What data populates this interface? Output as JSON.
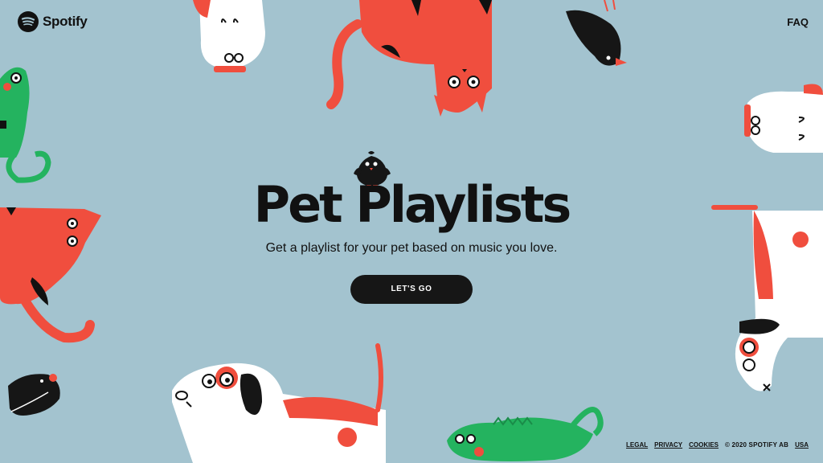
{
  "header": {
    "brand": "Spotify",
    "faq_label": "FAQ"
  },
  "hero": {
    "title": "Pet Playlists",
    "subtitle": "Get a playlist for your pet based on music you love.",
    "cta_label": "LET'S GO"
  },
  "footer": {
    "links": [
      "LEGAL",
      "PRIVACY",
      "COOKIES"
    ],
    "copyright": "© 2020 SPOTIFY AB",
    "region": "USA"
  },
  "icons": {
    "logo": "spotify-logo-icon",
    "mascot": "bird-icon"
  },
  "colors": {
    "background": "#a3c3cf",
    "red": "#f04e3e",
    "green": "#24b35f",
    "black": "#161616",
    "white": "#ffffff"
  }
}
